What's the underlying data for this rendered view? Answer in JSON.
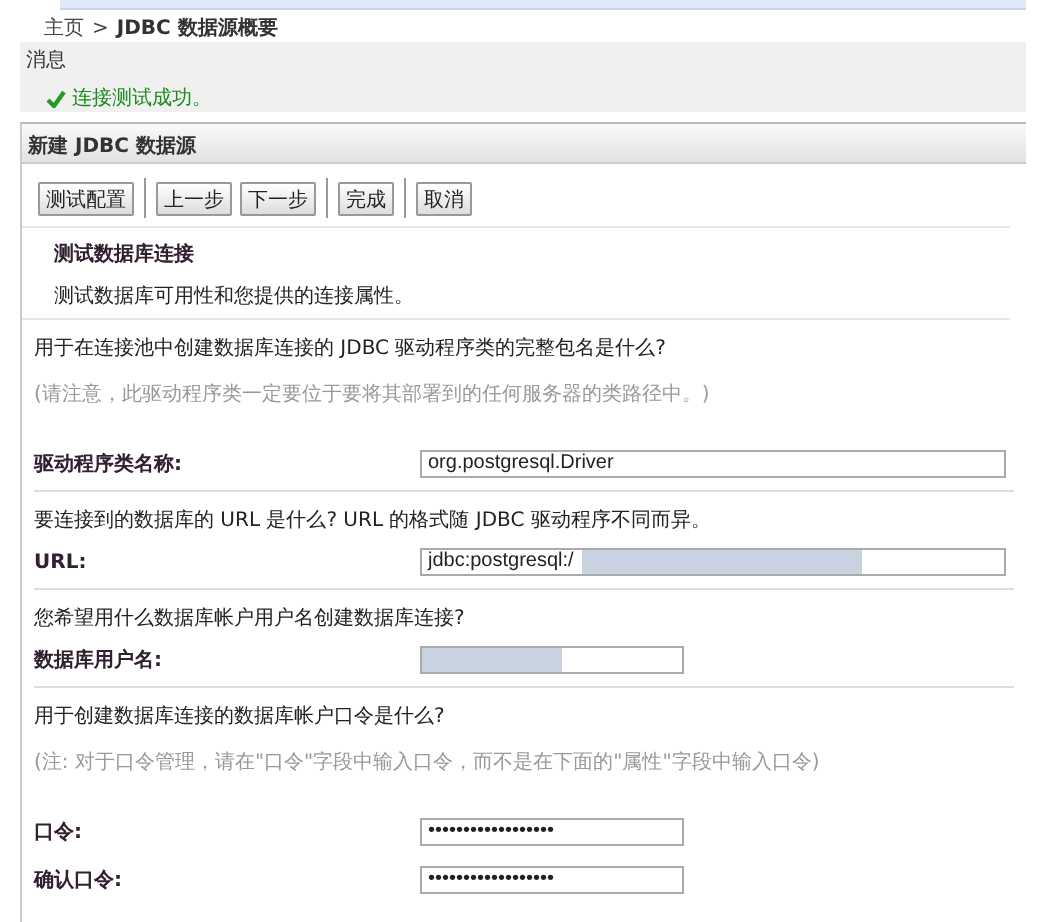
{
  "breadcrumb": {
    "home": "主页",
    "separator": ">",
    "current": "JDBC 数据源概要"
  },
  "messages": {
    "title": "消息",
    "items": [
      {
        "kind": "success",
        "text": "连接测试成功。"
      }
    ]
  },
  "panel": {
    "title": "新建 JDBC 数据源",
    "toolbar_groups": [
      [
        "测试配置"
      ],
      [
        "上一步",
        "下一步"
      ],
      [
        "完成"
      ],
      [
        "取消"
      ]
    ],
    "step": {
      "title": "测试数据库连接",
      "description": "测试数据库可用性和您提供的连接属性。"
    },
    "blocks": [
      {
        "kind": "question",
        "text": "用于在连接池中创建数据库连接的 JDBC 驱动程序类的完整包名是什么?"
      },
      {
        "kind": "note",
        "text": "(请注意，此驱动程序类一定要位于要将其部署到的任何服务器的类路径中。)"
      },
      {
        "kind": "field",
        "label": "驱动程序类名称:",
        "value": "org.postgresql.Driver",
        "wide": true,
        "redacted": false
      },
      {
        "kind": "divider"
      },
      {
        "kind": "question",
        "text": "要连接到的数据库的 URL 是什么? URL 的格式随 JDBC 驱动程序不同而异。"
      },
      {
        "kind": "field",
        "label": "URL:",
        "value": "jdbc:postgresql:/",
        "wide": true,
        "redacted": true
      },
      {
        "kind": "divider"
      },
      {
        "kind": "question",
        "text": "您希望用什么数据库帐户用户名创建数据库连接?"
      },
      {
        "kind": "field",
        "label": "数据库用户名:",
        "wide": false,
        "redacted": true
      },
      {
        "kind": "divider"
      },
      {
        "kind": "question",
        "text": "用于创建数据库连接的数据库帐户口令是什么?"
      },
      {
        "kind": "note",
        "text": "(注: 对于口令管理，请在\"口令\"字段中输入口令，而不是在下面的\"属性\"字段中输入口令)"
      },
      {
        "kind": "field",
        "label": "口令:",
        "value": "••••••••••••••••••",
        "wide": false,
        "redacted": false
      },
      {
        "kind": "field",
        "label": "确认口令:",
        "value": "••••••••••••••••••",
        "wide": false,
        "redacted": false
      }
    ]
  }
}
